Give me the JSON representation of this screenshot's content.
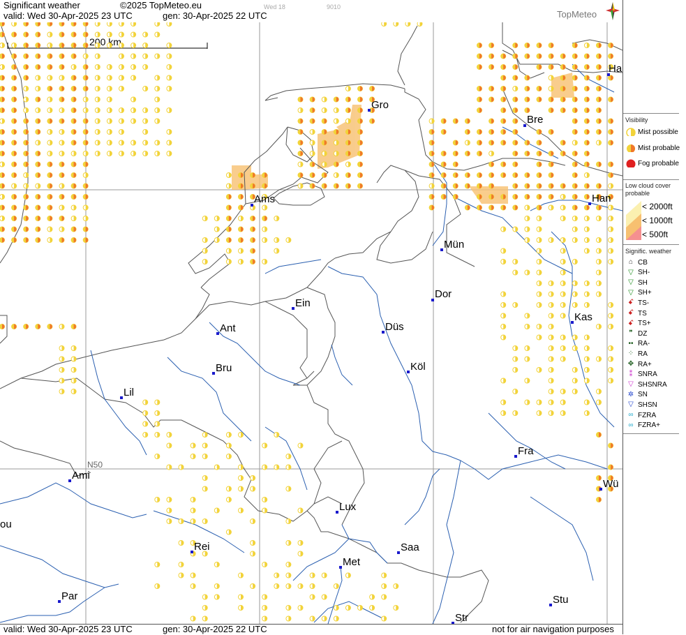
{
  "header": {
    "product": "Significant weather",
    "copyright": "©2025 TopMeteo.eu",
    "valid": "valid:  Wed  30-Apr-2025  23 UTC",
    "gen": "gen: 30-Apr-2025 22 UTC",
    "faint_day": "Wed 18",
    "faint_code": "9010",
    "logo": "TopMeteo"
  },
  "footer": {
    "valid": "valid:  Wed  30-Apr-2025  23 UTC",
    "gen": "gen: 30-Apr-2025 22 UTC",
    "disclaimer": "not for air navigation purposes"
  },
  "map": {
    "scale_label": "200 km",
    "lat_label": "N50",
    "cities": [
      {
        "name": "Gro"
      },
      {
        "name": "Bre"
      },
      {
        "name": "Ha"
      },
      {
        "name": "Ams"
      },
      {
        "name": "Han"
      },
      {
        "name": "Mün"
      },
      {
        "name": "Dor"
      },
      {
        "name": "Ein"
      },
      {
        "name": "Kas"
      },
      {
        "name": "Ant"
      },
      {
        "name": "Düs"
      },
      {
        "name": "Bru"
      },
      {
        "name": "Köl"
      },
      {
        "name": "Lil"
      },
      {
        "name": "Fra"
      },
      {
        "name": "Ami"
      },
      {
        "name": "Wü"
      },
      {
        "name": "Lux"
      },
      {
        "name": "ou"
      },
      {
        "name": "Rei"
      },
      {
        "name": "Saa"
      },
      {
        "name": "Met"
      },
      {
        "name": "Par"
      },
      {
        "name": "Stu"
      },
      {
        "name": "Str"
      }
    ],
    "colors": {
      "mist_possible": "#f2d33a",
      "mist_probable": "#f0782a",
      "fog": "#e02020",
      "water": "#2a5fb0",
      "border": "#555555",
      "grid": "#999999",
      "city_dot": "#1a1acc"
    }
  },
  "legend": {
    "visibility_title": "Visibility",
    "visibility": [
      {
        "label": "Mist possible",
        "icon": "mist-possible-icon"
      },
      {
        "label": "Mist probable",
        "icon": "mist-probable-icon"
      },
      {
        "label": "Fog probable",
        "icon": "fog-probable-icon"
      }
    ],
    "cloud_title_1": "Low cloud cover",
    "cloud_title_2": "probable",
    "cloud": [
      {
        "label": "< 2000ft",
        "color": "#fbf0b0"
      },
      {
        "label": "< 1000ft",
        "color": "#f7c070"
      },
      {
        "label": "<  500ft",
        "color": "#f59090"
      }
    ],
    "weather_title": "Signific. weather",
    "weather": [
      {
        "label": "CB",
        "icon": "cb-icon",
        "color": "#333333"
      },
      {
        "label": "SH-",
        "icon": "shower-light-icon",
        "color": "#1a8c1a"
      },
      {
        "label": "SH",
        "icon": "shower-icon",
        "color": "#1a8c1a"
      },
      {
        "label": "SH+",
        "icon": "shower-heavy-icon",
        "color": "#1a8c1a"
      },
      {
        "label": "TS-",
        "icon": "thunder-light-icon",
        "color": "#cc2222"
      },
      {
        "label": "TS",
        "icon": "thunder-icon",
        "color": "#cc2222"
      },
      {
        "label": "TS+",
        "icon": "thunder-heavy-icon",
        "color": "#cc2222"
      },
      {
        "label": "DZ",
        "icon": "drizzle-icon",
        "color": "#1a5a1a"
      },
      {
        "label": "RA-",
        "icon": "rain-light-icon",
        "color": "#1a5a1a"
      },
      {
        "label": "RA",
        "icon": "rain-icon",
        "color": "#1a5a1a"
      },
      {
        "label": "RA+",
        "icon": "rain-heavy-icon",
        "color": "#1a5a1a"
      },
      {
        "label": "SNRA",
        "icon": "sleet-icon",
        "color": "#cc33cc"
      },
      {
        "label": "SHSNRA",
        "icon": "sleet-shower-icon",
        "color": "#cc33cc"
      },
      {
        "label": "SN",
        "icon": "snow-icon",
        "color": "#2244cc"
      },
      {
        "label": "SHSN",
        "icon": "snow-shower-icon",
        "color": "#2244cc"
      },
      {
        "label": "FZRA",
        "icon": "freezing-rain-icon",
        "color": "#22aacc"
      },
      {
        "label": "FZRA+",
        "icon": "freezing-rain-heavy-icon",
        "color": "#22aacc"
      }
    ]
  }
}
